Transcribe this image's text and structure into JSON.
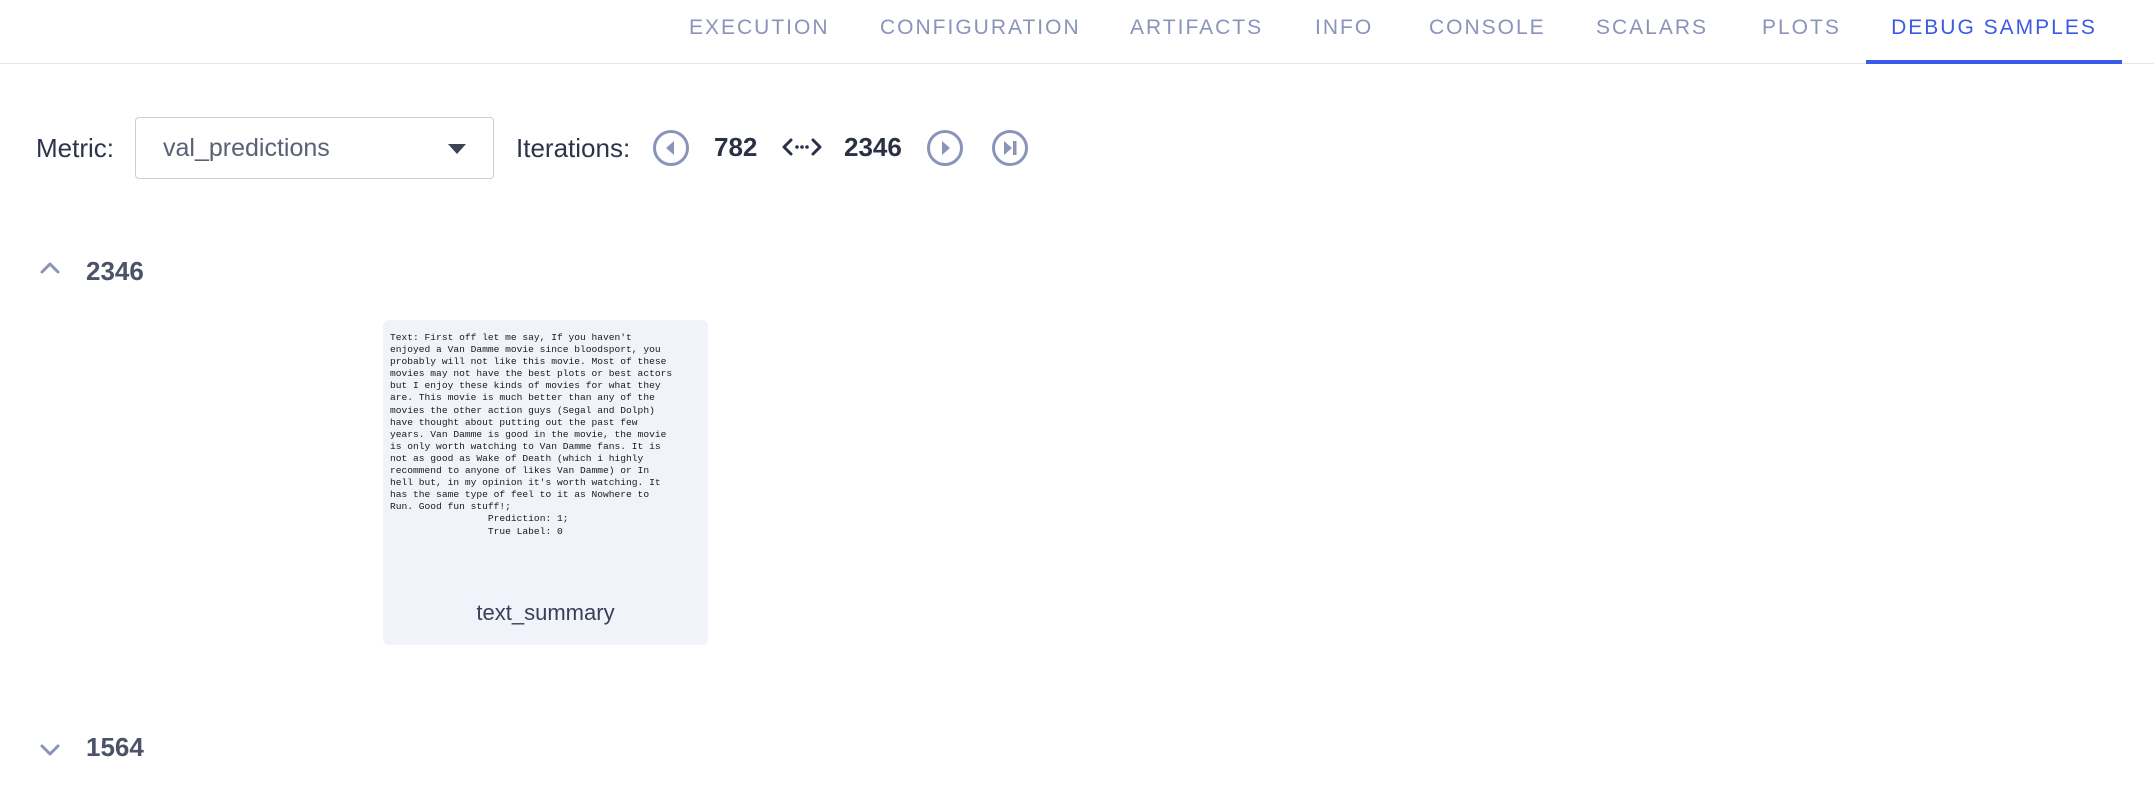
{
  "tabs": [
    {
      "label": "EXECUTION"
    },
    {
      "label": "CONFIGURATION"
    },
    {
      "label": "ARTIFACTS"
    },
    {
      "label": "INFO"
    },
    {
      "label": "CONSOLE"
    },
    {
      "label": "SCALARS"
    },
    {
      "label": "PLOTS"
    },
    {
      "label": "DEBUG SAMPLES",
      "active": true
    }
  ],
  "metric": {
    "label": "Metric:",
    "selected": "val_predictions"
  },
  "iterations": {
    "label": "Iterations:",
    "from": "782",
    "to": "2346"
  },
  "groups": [
    {
      "iteration": "2346",
      "expanded": true,
      "samples": [
        {
          "caption": "text_summary",
          "preview_text": "Text: First off let me say, If you haven't\nenjoyed a Van Damme movie since bloodsport, you\nprobably will not like this movie. Most of these\nmovies may not have the best plots or best actors\nbut I enjoy these kinds of movies for what they\nare. This movie is much better than any of the\nmovies the other action guys (Segal and Dolph)\nhave thought about putting out the past few\nyears. Van Damme is good in the movie, the movie\nis only worth watching to Van Damme fans. It is\nnot as good as Wake of Death (which i highly\nrecommend to anyone of likes Van Damme) or In\nhell but, in my opinion it's worth watching. It\nhas the same type of feel to it as Nowhere to\nRun. Good fun stuff!;\n                 Prediction: 1;\n                 True Label: 0"
        }
      ]
    },
    {
      "iteration": "1564",
      "expanded": false
    }
  ],
  "icons": {
    "prev": "chevron-left-circle-icon",
    "next": "chevron-right-circle-icon",
    "last": "skip-to-last-icon",
    "swap": "left-right-arrows-icon",
    "collapse": "chevron-up-icon",
    "expand": "chevron-down-icon",
    "dropdown": "caret-down-icon"
  },
  "colors": {
    "accent": "#3c5ae6",
    "tab_text": "#8a93b9",
    "card_bg": "#f1f3fa",
    "icon": "#8a93b9"
  }
}
